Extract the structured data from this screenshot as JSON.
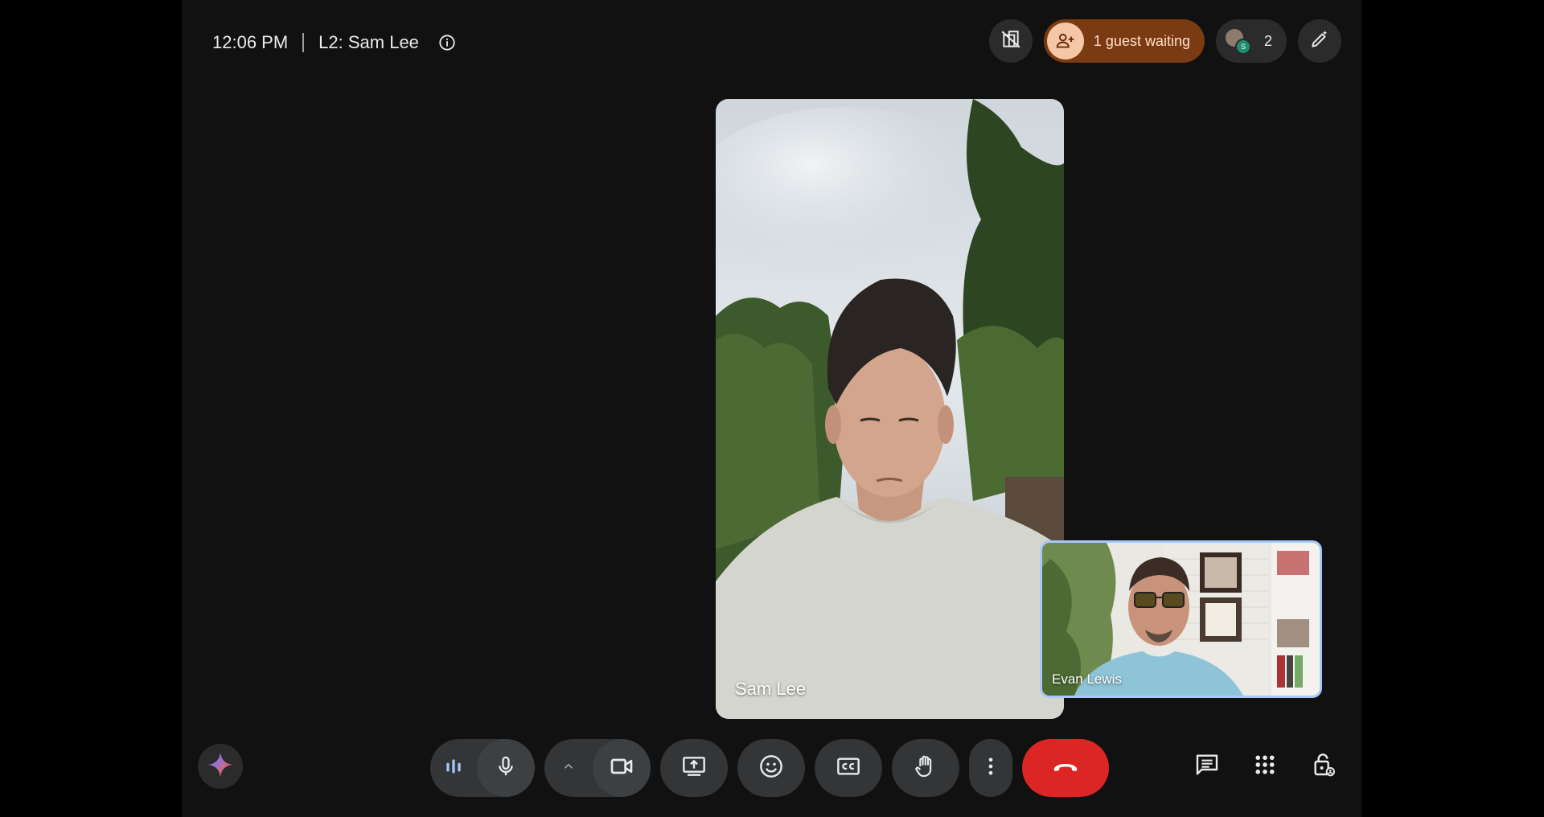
{
  "header": {
    "time": "12:06 PM",
    "meeting_name": "L2: Sam Lee"
  },
  "top_right": {
    "guest_waiting_label": "1 guest waiting",
    "participant_count": "2",
    "avatar_initial": "S"
  },
  "videos": {
    "main_participant_name": "Sam Lee",
    "self_participant_name": "Evan Lewis"
  },
  "colors": {
    "end_call": "#dc2626",
    "guest_pill": "#7a3a12",
    "self_tile_border": "#a8c7fa"
  },
  "icons": {
    "top": [
      "info-icon",
      "background-off-icon",
      "add-person-icon",
      "pencil-sparkle-icon"
    ],
    "bottom": [
      "gemini-icon",
      "audio-levels-icon",
      "microphone-icon",
      "chevron-up-icon",
      "camera-icon",
      "present-screen-icon",
      "emoji-icon",
      "captions-icon",
      "raise-hand-icon",
      "more-options-icon",
      "end-call-icon",
      "chat-icon",
      "activities-icon",
      "host-controls-icon"
    ]
  }
}
